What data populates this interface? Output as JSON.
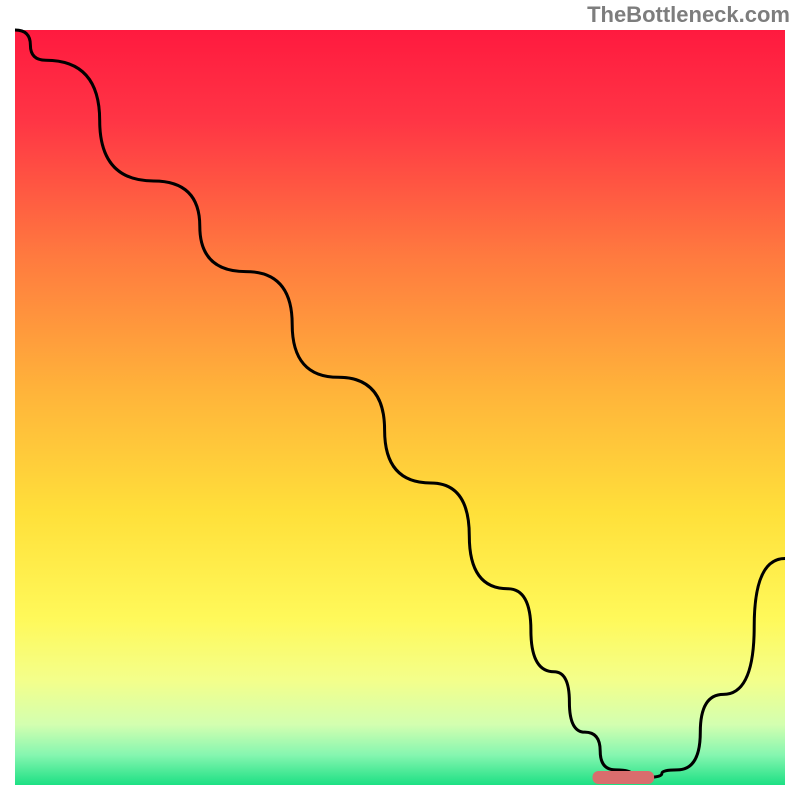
{
  "watermark": "TheBottleneck.com",
  "chart_data": {
    "type": "line",
    "title": "",
    "xlabel": "",
    "ylabel": "",
    "xlim": [
      0,
      100
    ],
    "ylim": [
      0,
      100
    ],
    "grid": false,
    "legend": false,
    "background": {
      "style": "vertical-gradient",
      "stops": [
        {
          "offset": 0.0,
          "color": "#ff1a3f"
        },
        {
          "offset": 0.12,
          "color": "#ff3545"
        },
        {
          "offset": 0.3,
          "color": "#ff7a3f"
        },
        {
          "offset": 0.48,
          "color": "#ffb43a"
        },
        {
          "offset": 0.64,
          "color": "#ffe03a"
        },
        {
          "offset": 0.78,
          "color": "#fff95a"
        },
        {
          "offset": 0.86,
          "color": "#f4ff8a"
        },
        {
          "offset": 0.92,
          "color": "#d3ffb0"
        },
        {
          "offset": 0.96,
          "color": "#86f6b0"
        },
        {
          "offset": 1.0,
          "color": "#1de084"
        }
      ]
    },
    "series": [
      {
        "name": "bottleneck-curve",
        "x": [
          0,
          4,
          18,
          30,
          42,
          54,
          64,
          70,
          74,
          78,
          82,
          86,
          92,
          100
        ],
        "y": [
          100,
          96,
          80,
          68,
          54,
          40,
          26,
          15,
          7,
          2,
          1,
          2,
          12,
          30
        ]
      }
    ],
    "marker": {
      "name": "optimal-range",
      "x_start": 75,
      "x_end": 83,
      "y": 1,
      "color": "#d96d6d"
    }
  }
}
